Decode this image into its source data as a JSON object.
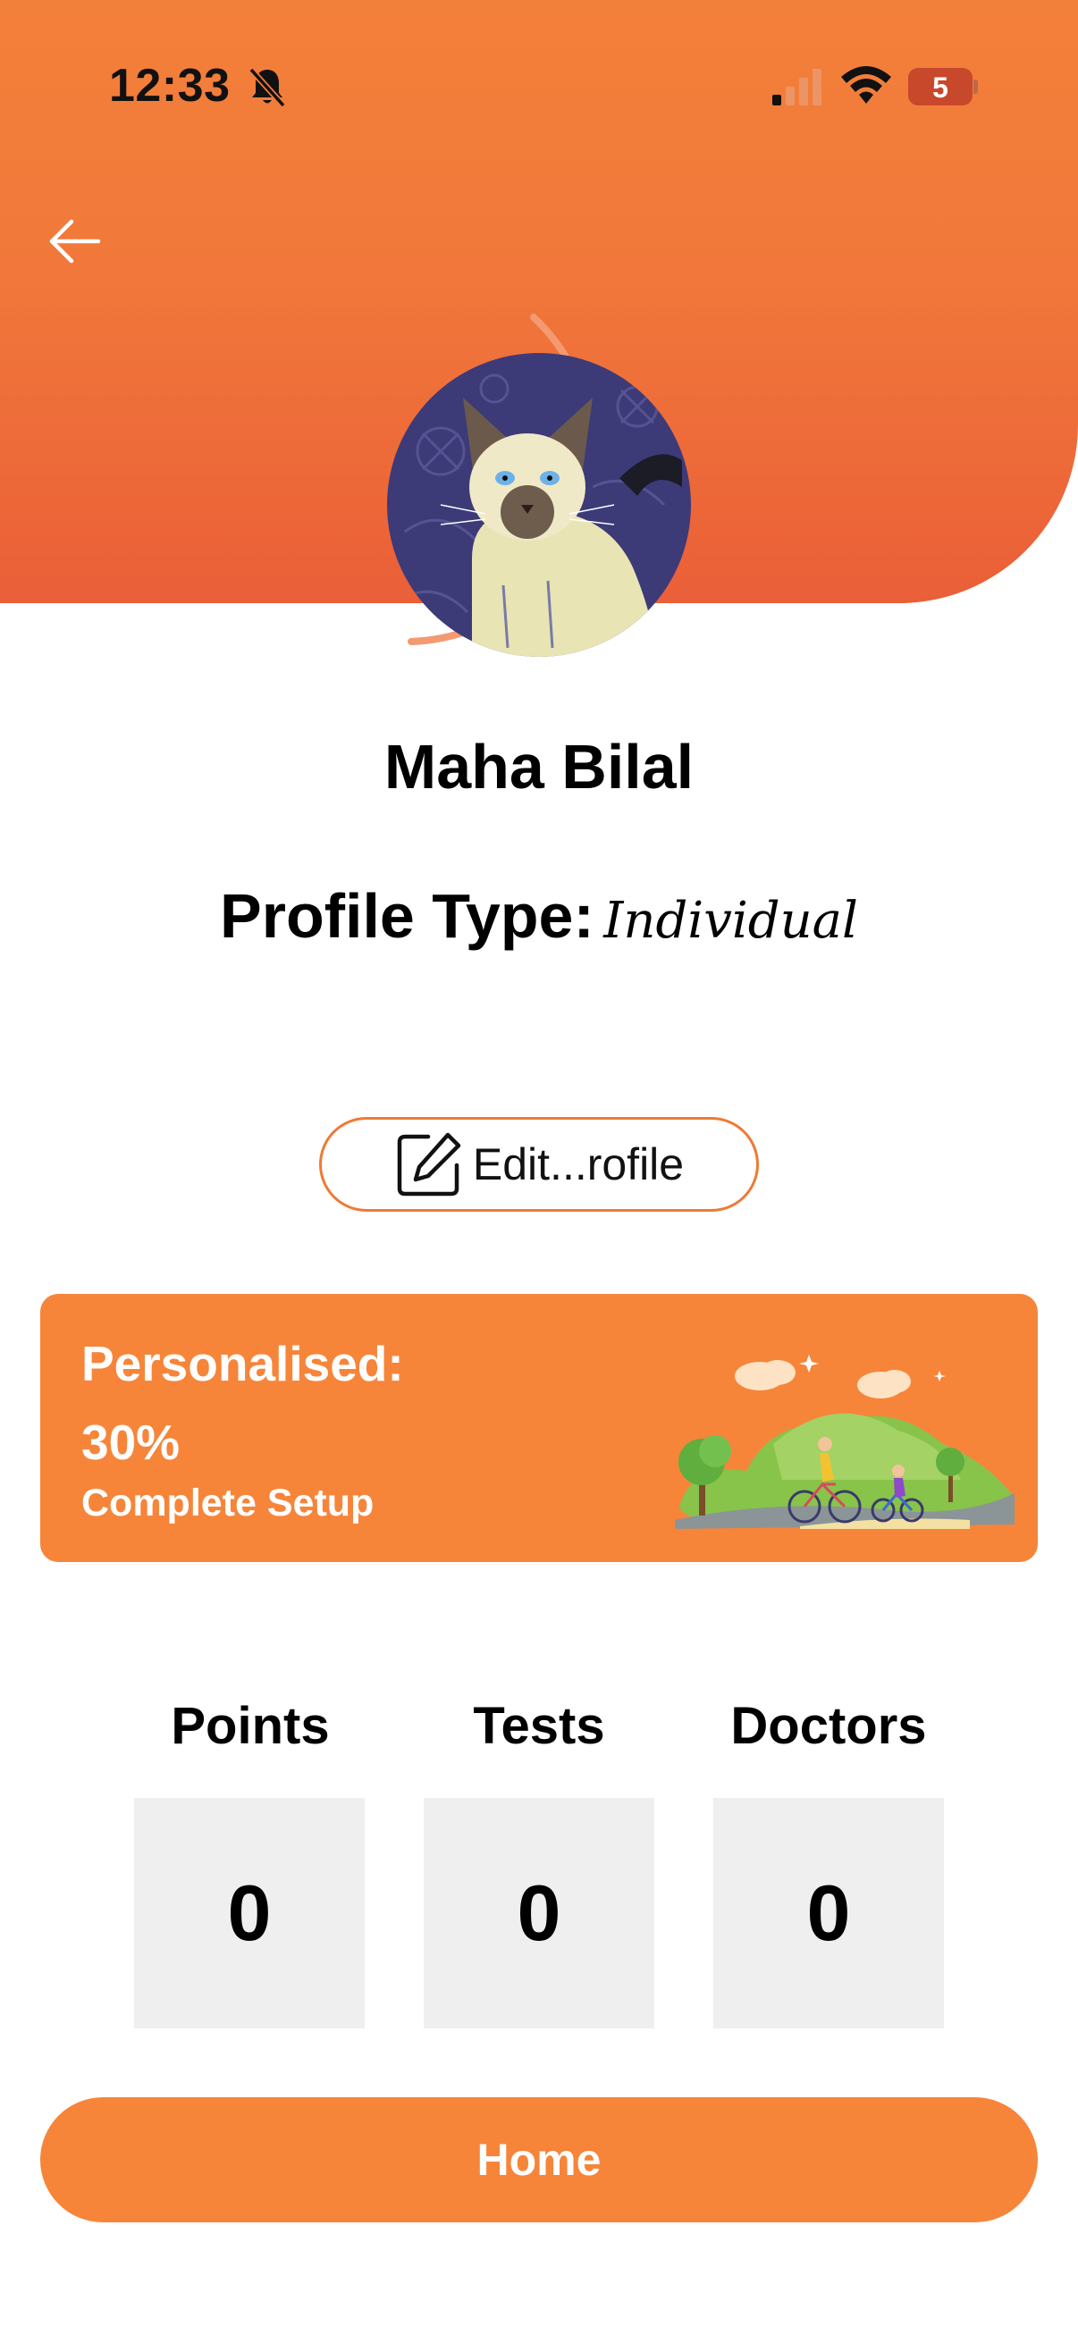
{
  "status_bar": {
    "time": "12:33",
    "battery": "5",
    "icons": [
      "bell-slash-icon",
      "cellular-signal-icon",
      "wifi-icon",
      "battery-icon"
    ]
  },
  "header": {
    "back_icon": "arrow-left-icon"
  },
  "profile": {
    "name": "Maha Bilal",
    "type_label": "Profile Type:",
    "type_value": "Individual",
    "edit_label": "Edit...rofile",
    "edit_icon": "edit-square-icon"
  },
  "setup_card": {
    "title": "Personalised:",
    "percent": "30%",
    "progress": 0.3,
    "link": "Complete Setup"
  },
  "stats": [
    {
      "label": "Points",
      "value": "0"
    },
    {
      "label": "Tests",
      "value": "0"
    },
    {
      "label": "Doctors",
      "value": "0"
    }
  ],
  "home_button": "Home",
  "colors": {
    "accent": "#f6853a",
    "header_gradient_top": "#f3803a",
    "header_gradient_bottom": "#ea5f38",
    "stat_box": "#efefef"
  }
}
